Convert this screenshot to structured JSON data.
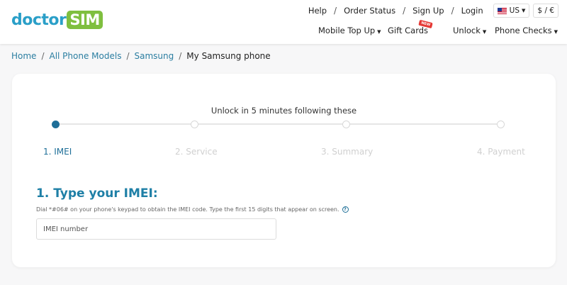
{
  "brand": {
    "part1": "doctor",
    "part2": "SIM"
  },
  "topnav": {
    "help": "Help",
    "order_status": "Order Status",
    "sign_up": "Sign Up",
    "login": "Login",
    "separator": "/",
    "country": "US",
    "currency": "$ / €"
  },
  "mainnav": {
    "mobile_top_up": "Mobile Top Up",
    "gift_cards": "Gift Cards",
    "gift_badge": "NEW",
    "unlock": "Unlock",
    "phone_checks": "Phone Checks",
    "caret": "▼"
  },
  "breadcrumb": {
    "home": "Home",
    "all_models": "All Phone Models",
    "samsung": "Samsung",
    "current": "My Samsung phone",
    "separator": "/"
  },
  "steps": {
    "title": "Unlock in 5 minutes following these",
    "items": [
      {
        "label": "1. IMEI",
        "active": true
      },
      {
        "label": "2. Service",
        "active": false
      },
      {
        "label": "3. Summary",
        "active": false
      },
      {
        "label": "4. Payment",
        "active": false
      }
    ]
  },
  "imei_section": {
    "title": "1. Type your IMEI:",
    "hint": "Dial *#06# on your phone's keypad to obtain the IMEI code. Type the first 15 digits that appear on screen.",
    "help_glyph": "?",
    "input_placeholder": "IMEI number",
    "input_value": ""
  }
}
